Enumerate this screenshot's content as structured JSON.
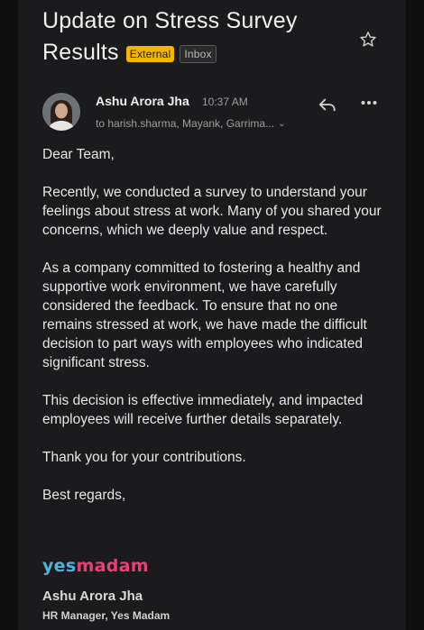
{
  "email": {
    "subject_line1": "Update on Stress Survey",
    "subject_line2": "Results",
    "labels": {
      "external": "External",
      "inbox": "Inbox"
    },
    "sender": {
      "name": "Ashu Arora Jha",
      "time": "10:37 AM",
      "recipients": "to harish.sharma, Mayank, Garrima..."
    },
    "icons": [
      "star-icon",
      "reply-icon",
      "more-vert-icon",
      "chevron-down-icon"
    ],
    "body": {
      "greeting": "Dear Team,",
      "para1": "Recently, we conducted a survey to understand your feelings about stress at work. Many of you shared your concerns, which we deeply value and respect.",
      "para2": "As a company committed to fostering a healthy and supportive work environment, we have carefully considered the feedback. To ensure that no one remains stressed at work, we have made the difficult decision to part ways with employees who indicated significant stress.",
      "para3": "This decision is effective immediately, and impacted employees will receive further details separately.",
      "thanks": "Thank you for your contributions.",
      "closing": "Best regards,"
    },
    "signature": {
      "logo_part1": "yes",
      "logo_part2": "madam",
      "name": "Ashu Arora Jha",
      "title": "HR Manager, Yes Madam"
    }
  },
  "colors": {
    "background": "#1b1b1d",
    "external_badge": "#f4b400",
    "logo_blue": "#4fb3d9",
    "logo_pink": "#ec3f78"
  }
}
